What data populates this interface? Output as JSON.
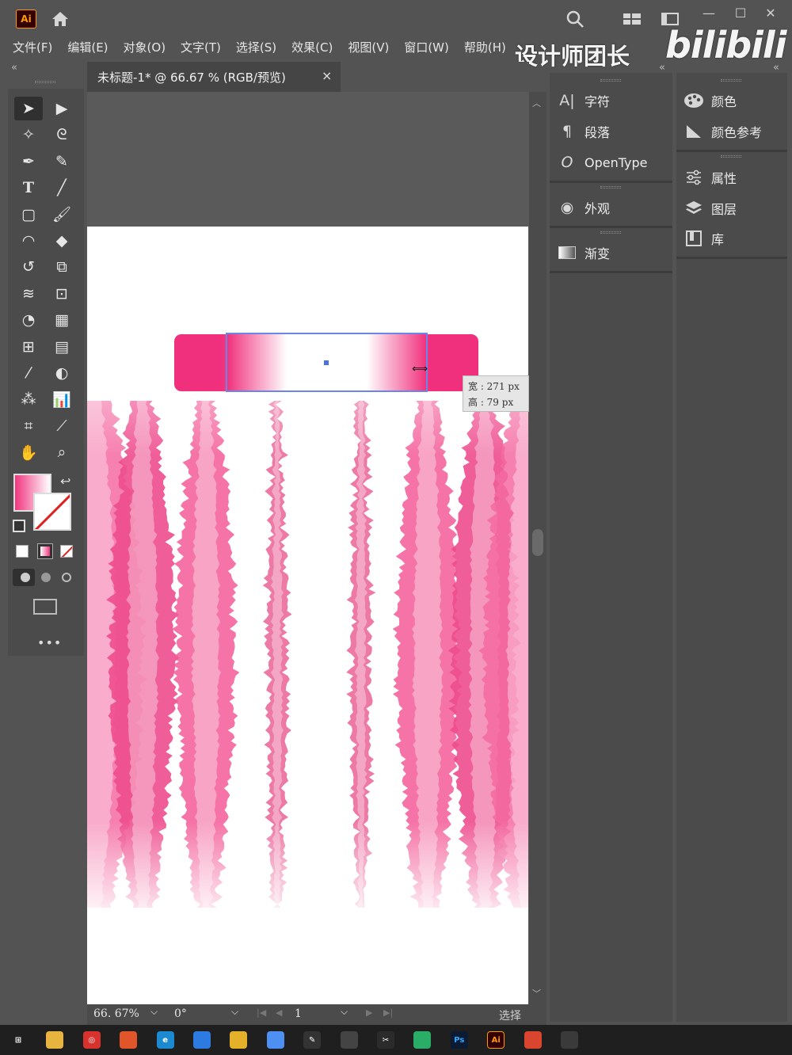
{
  "app": {
    "logo": "Ai",
    "window_controls": {
      "minimize": "—",
      "maximize": "☐",
      "close": "✕"
    },
    "collapse_left": "«",
    "collapse_right": "«"
  },
  "menu": [
    "文件(F)",
    "编辑(E)",
    "对象(O)",
    "文字(T)",
    "选择(S)",
    "效果(C)",
    "视图(V)",
    "窗口(W)",
    "帮助(H)"
  ],
  "watermark": {
    "team": "设计师团长",
    "brand": "bilibili"
  },
  "document": {
    "tab_title": "未标题-1* @ 66.67 % (RGB/预览)",
    "close": "×"
  },
  "tools": [
    [
      "selection-tool",
      "direct-selection-tool"
    ],
    [
      "magic-wand-tool",
      "lasso-tool"
    ],
    [
      "pen-tool",
      "curvature-tool"
    ],
    [
      "type-tool",
      "line-segment-tool"
    ],
    [
      "rectangle-tool",
      "paintbrush-tool"
    ],
    [
      "shaper-tool",
      "eraser-tool"
    ],
    [
      "rotate-tool",
      "scale-tool"
    ],
    [
      "warp-tool",
      "free-transform-tool"
    ],
    [
      "shape-builder-tool",
      "perspective-grid-tool"
    ],
    [
      "mesh-tool",
      "gradient-tool"
    ],
    [
      "eyedropper-tool",
      "blend-tool"
    ],
    [
      "symbol-sprayer-tool",
      "column-graph-tool"
    ],
    [
      "artboard-tool",
      "slice-tool"
    ],
    [
      "hand-tool",
      "zoom-tool"
    ]
  ],
  "toolbar_more": "•••",
  "selection": {
    "width_label": "宽 : 271 px",
    "height_label": "高 : 79 px"
  },
  "status": {
    "zoom": "66. 67%",
    "rotation": "0°",
    "artboard": "1",
    "mode": "选择"
  },
  "panels_mid": [
    {
      "icon": "character-icon",
      "glyph": "A|",
      "label": "字符"
    },
    {
      "icon": "paragraph-icon",
      "glyph": "¶",
      "label": "段落"
    },
    {
      "icon": "opentype-icon",
      "glyph": "O",
      "label": "OpenType"
    },
    {
      "icon": "appearance-icon",
      "glyph": "◉",
      "label": "外观"
    },
    {
      "icon": "gradient-icon",
      "glyph": "▭",
      "label": "渐变"
    }
  ],
  "panels_right": [
    {
      "icon": "color-icon",
      "glyph": "🎨",
      "label": "颜色"
    },
    {
      "icon": "color-guide-icon",
      "glyph": "◭",
      "label": "颜色参考"
    },
    {
      "icon": "properties-icon",
      "glyph": "☰",
      "label": "属性"
    },
    {
      "icon": "layers-icon",
      "glyph": "◈",
      "label": "图层"
    },
    {
      "icon": "libraries-icon",
      "glyph": "▣",
      "label": "库"
    }
  ],
  "taskbar": [
    {
      "name": "windows-start-icon",
      "label": "⊞",
      "color": "#1f1f1f"
    },
    {
      "name": "file-explorer-icon",
      "label": "",
      "color": "#e8b440"
    },
    {
      "name": "netease-music-icon",
      "label": "◎",
      "color": "#d8322e"
    },
    {
      "name": "office-icon",
      "label": "",
      "color": "#e0562a"
    },
    {
      "name": "edge-icon",
      "label": "e",
      "color": "#1b8ad0"
    },
    {
      "name": "app-blue-icon",
      "label": "",
      "color": "#2d7be0"
    },
    {
      "name": "chrome-icon",
      "label": "",
      "color": "#e3b129"
    },
    {
      "name": "browser-icon",
      "label": "",
      "color": "#4e8ff2"
    },
    {
      "name": "pen-app-icon",
      "label": "✎",
      "color": "#333333"
    },
    {
      "name": "storage-app-icon",
      "label": "",
      "color": "#444444"
    },
    {
      "name": "capcut-icon",
      "label": "✂",
      "color": "#2b2b2b"
    },
    {
      "name": "wechat-icon",
      "label": "",
      "color": "#2aae67"
    },
    {
      "name": "photoshop-icon",
      "label": "Ps",
      "color": "#0b1b33"
    },
    {
      "name": "illustrator-icon",
      "label": "Ai",
      "color": "#330000"
    },
    {
      "name": "chrome-2-icon",
      "label": "",
      "color": "#d9452f"
    },
    {
      "name": "recorder-icon",
      "label": "",
      "color": "#3a3a3a"
    }
  ]
}
